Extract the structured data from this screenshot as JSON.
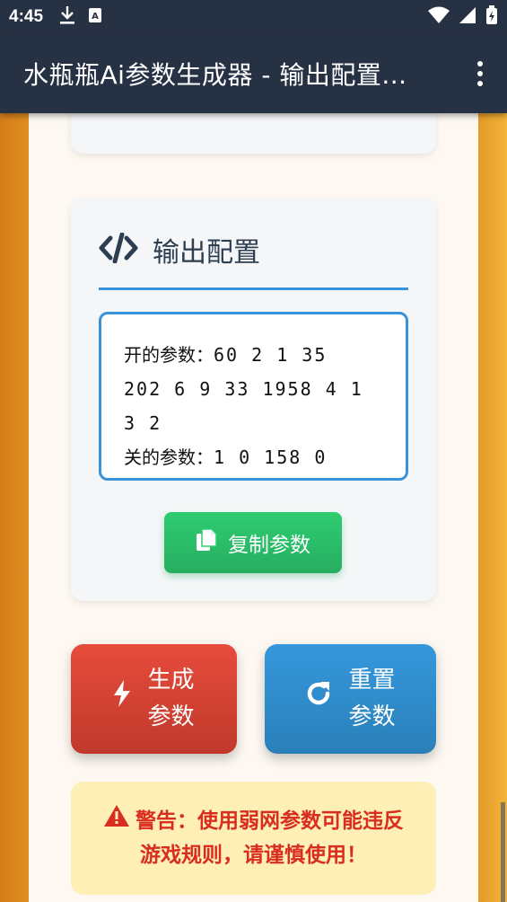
{
  "status_bar": {
    "time": "4:45"
  },
  "app_bar": {
    "title": "水瓶瓶Ai参数生成器 - 输出配置..."
  },
  "output_card": {
    "title": "输出配置",
    "on_label": "开的参数：",
    "on_values_line1": "60 2 1 35",
    "on_values_line2": "202 6 9 33 1958 4 1",
    "on_values_line3": "3 2",
    "off_label": "关的参数：",
    "off_values": "1 0 158 0",
    "copy_label": "复制参数"
  },
  "actions": {
    "generate_line1": "生成",
    "generate_line2": "参数",
    "reset_line1": "重置",
    "reset_line2": "参数"
  },
  "warning": {
    "line1": "警告：使用弱网参数可能违反",
    "line2": "游戏规则，请谨慎使用！"
  },
  "colors": {
    "appbar": "#263143",
    "accent_blue": "#3a92d9",
    "green": "#27ae60",
    "red": "#c0392b",
    "blue": "#2a80b9",
    "warning_text": "#d92d1f",
    "warning_bg": "#fdefb6"
  },
  "icons": [
    "download-icon",
    "sim-card-icon",
    "wifi-icon",
    "signal-icon",
    "battery-icon",
    "more-vert-icon",
    "code-icon",
    "copy-icon",
    "bolt-icon",
    "redo-icon",
    "warning-icon"
  ]
}
